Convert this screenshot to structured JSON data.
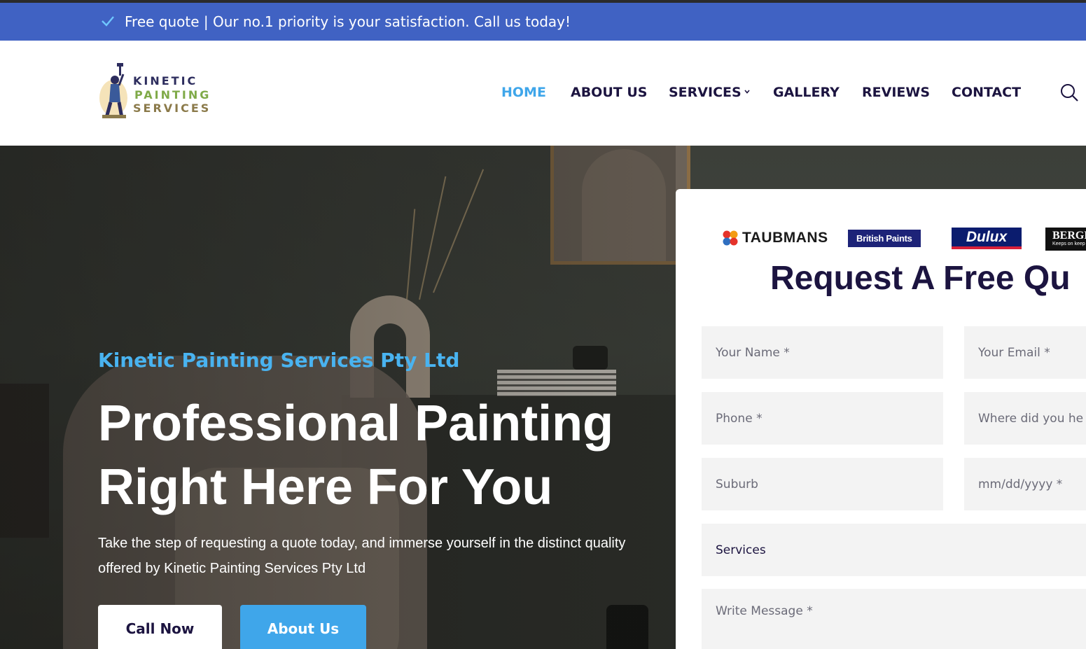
{
  "topbar": {
    "message": "Free quote | Our no.1 priority is your satisfaction. Call us today!"
  },
  "logo": {
    "line1": "KINETIC",
    "line2": "PAINTING",
    "line3": "SERVICES"
  },
  "nav": {
    "items": [
      {
        "label": "HOME",
        "active": true
      },
      {
        "label": "ABOUT US"
      },
      {
        "label": "SERVICES",
        "has_dropdown": true
      },
      {
        "label": "GALLERY"
      },
      {
        "label": "REVIEWS"
      },
      {
        "label": "CONTACT"
      }
    ],
    "search_icon": "search-icon"
  },
  "hero": {
    "subtitle": "Kinetic Painting Services Pty Ltd",
    "title_line1": "Professional Painting",
    "title_line2": "Right Here For You",
    "text": "Take the step of requesting a quote today, and immerse yourself in the distinct quality offered by Kinetic Painting Services Pty Ltd",
    "call_button": "Call Now",
    "about_button": "About Us"
  },
  "quote_form": {
    "brands": {
      "taubmans": "TAUBMANS",
      "british_paints": "British Paints",
      "dulux": "Dulux",
      "berger": "BERGE",
      "berger_tag": "Keeps on keep"
    },
    "title": "Request A Free Qu",
    "fields": {
      "name": "Your Name *",
      "email": "Your Email *",
      "phone": "Phone *",
      "referral": "Where did you he",
      "suburb": "Suburb",
      "date": "mm/dd/yyyy *",
      "services": "Services",
      "message": "Write Message *"
    }
  },
  "colors": {
    "topbar": "#4062c3",
    "accent": "#3fa6ea",
    "navy": "#1c1440",
    "field_bg": "#f3f3f3"
  }
}
